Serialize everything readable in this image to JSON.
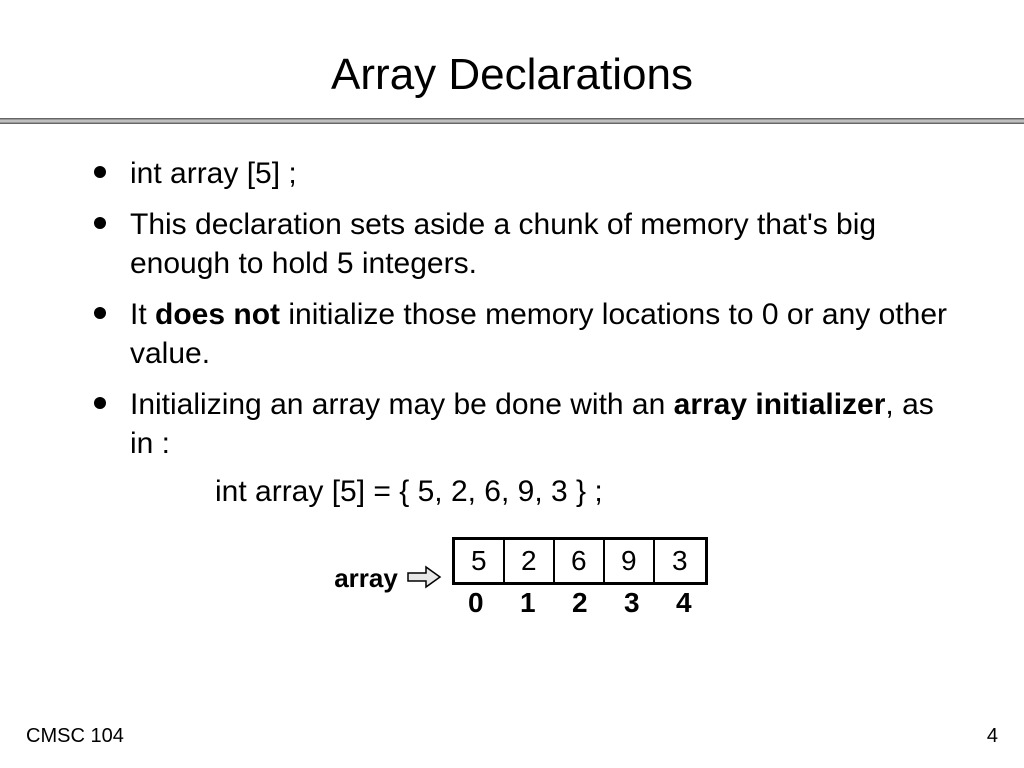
{
  "title": "Array Declarations",
  "bullets": {
    "b1": "int  array [5] ;",
    "b2": "This declaration sets aside a chunk of memory that's big enough to hold 5 integers.",
    "b3_pre": "It ",
    "b3_bold": "does not",
    "b3_post": " initialize those memory locations to 0 or any other value.",
    "b4_pre": "Initializing an array may be done with an ",
    "b4_bold": "array initializer",
    "b4_post": ", as in :"
  },
  "code_example": "int  array [5] = { 5, 2, 6, 9, 3 } ;",
  "diagram": {
    "label": "array",
    "values": [
      "5",
      "2",
      "6",
      "9",
      "3"
    ],
    "indices": [
      "0",
      "1",
      "2",
      "3",
      "4"
    ]
  },
  "footer": {
    "left": "CMSC 104",
    "right": "4"
  }
}
